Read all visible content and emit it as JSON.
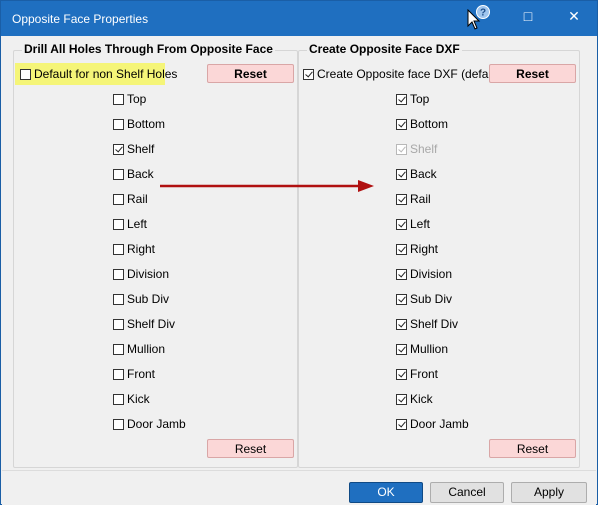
{
  "window": {
    "title": "Opposite Face Properties"
  },
  "titlebar": {
    "minimize": "□",
    "close": "✕",
    "help_icon": "help-cursor-icon"
  },
  "left_group": {
    "title": "Drill All Holes Through From Opposite Face",
    "default_checkbox": {
      "label": "Default for non Shelf Holes",
      "checked": false
    },
    "reset_top": "Reset",
    "reset_bottom": "Reset",
    "items": [
      {
        "label": "Top",
        "checked": false
      },
      {
        "label": "Bottom",
        "checked": false
      },
      {
        "label": "Shelf",
        "checked": true
      },
      {
        "label": "Back",
        "checked": false
      },
      {
        "label": "Rail",
        "checked": false
      },
      {
        "label": "Left",
        "checked": false
      },
      {
        "label": "Right",
        "checked": false
      },
      {
        "label": "Division",
        "checked": false
      },
      {
        "label": "Sub Div",
        "checked": false
      },
      {
        "label": "Shelf Div",
        "checked": false
      },
      {
        "label": "Mullion",
        "checked": false
      },
      {
        "label": "Front",
        "checked": false
      },
      {
        "label": "Kick",
        "checked": false
      },
      {
        "label": "Door Jamb",
        "checked": false
      }
    ]
  },
  "right_group": {
    "title": "Create Opposite Face DXF",
    "default_checkbox": {
      "label": "Create Opposite face DXF (default)",
      "checked": true
    },
    "reset_top": "Reset",
    "reset_bottom": "Reset",
    "items": [
      {
        "label": "Top",
        "checked": true,
        "disabled": false
      },
      {
        "label": "Bottom",
        "checked": true,
        "disabled": false
      },
      {
        "label": "Shelf",
        "checked": true,
        "disabled": true
      },
      {
        "label": "Back",
        "checked": true,
        "disabled": false
      },
      {
        "label": "Rail",
        "checked": true,
        "disabled": false
      },
      {
        "label": "Left",
        "checked": true,
        "disabled": false
      },
      {
        "label": "Right",
        "checked": true,
        "disabled": false
      },
      {
        "label": "Division",
        "checked": true,
        "disabled": false
      },
      {
        "label": "Sub Div",
        "checked": true,
        "disabled": false
      },
      {
        "label": "Shelf Div",
        "checked": true,
        "disabled": false
      },
      {
        "label": "Mullion",
        "checked": true,
        "disabled": false
      },
      {
        "label": "Front",
        "checked": true,
        "disabled": false
      },
      {
        "label": "Kick",
        "checked": true,
        "disabled": false
      },
      {
        "label": "Door Jamb",
        "checked": true,
        "disabled": false
      }
    ]
  },
  "footer": {
    "ok": "OK",
    "cancel": "Cancel",
    "apply": "Apply"
  },
  "colors": {
    "accent": "#1f6fc0",
    "reset_bg": "#fbd7d7",
    "highlight": "#f5f578",
    "arrow": "#b01010"
  }
}
